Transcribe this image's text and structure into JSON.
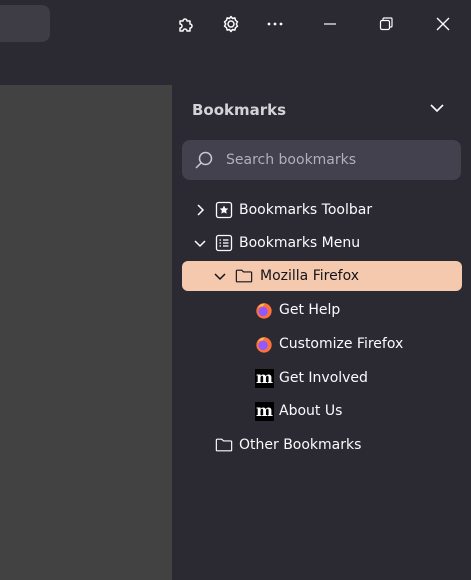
{
  "sidebar": {
    "title": "Bookmarks",
    "search_placeholder": "Search bookmarks",
    "items": [
      {
        "label": "Bookmarks Toolbar"
      },
      {
        "label": "Bookmarks Menu"
      },
      {
        "label": "Mozilla Firefox"
      },
      {
        "label": "Get Help"
      },
      {
        "label": "Customize Firefox"
      },
      {
        "label": "Get Involved"
      },
      {
        "label": "About Us"
      },
      {
        "label": "Other Bookmarks"
      }
    ]
  },
  "colors": {
    "selected_row": "#f4c9ae",
    "sidebar_bg": "#2b2a33",
    "content_bg": "#424242",
    "search_bg": "#42414d"
  },
  "icons": [
    "extensions-icon",
    "settings-icon",
    "more-icon",
    "minimize-icon",
    "restore-icon",
    "close-icon",
    "chevron-down-icon",
    "search-icon",
    "folder-icon",
    "firefox-icon",
    "mozilla-icon"
  ]
}
